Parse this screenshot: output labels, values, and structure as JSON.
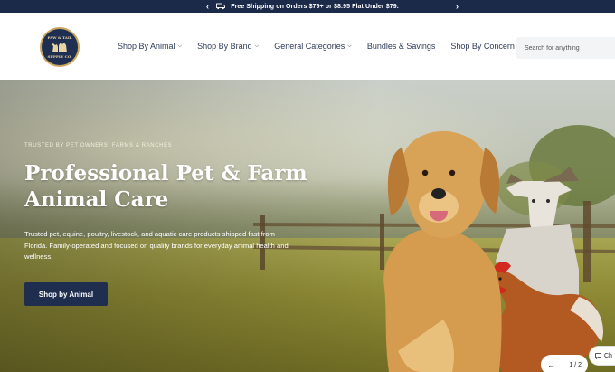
{
  "announcement": {
    "message": "Free Shipping on Orders $79+ or $8.95 Flat Under $79.",
    "prev_icon": "‹",
    "next_icon": "›"
  },
  "header": {
    "logo": {
      "line1": "PAW & TAIL",
      "line2": "SUPPLY CO."
    },
    "nav": [
      {
        "label": "Shop By Animal",
        "has_dropdown": true
      },
      {
        "label": "Shop By Brand",
        "has_dropdown": true
      },
      {
        "label": "General Categories",
        "has_dropdown": true
      },
      {
        "label": "Bundles & Savings",
        "has_dropdown": false
      },
      {
        "label": "Shop By Concern",
        "has_dropdown": false
      }
    ],
    "search": {
      "placeholder": "Search for anything",
      "value": ""
    }
  },
  "hero": {
    "eyebrow": "TRUSTED BY PET OWNERS, FARMS & RANCHES",
    "headline": "Professional Pet & Farm Animal Care",
    "subcopy": "Trusted pet, equine, poultry, livestock, and aquatic care products shipped fast from Florida. Family-operated and focused on quality brands for everyday animal health and wellness.",
    "cta_label": "Shop by Animal",
    "pager": {
      "prev_icon": "←",
      "text": "1 / 2"
    },
    "chat_label": "Ch"
  },
  "colors": {
    "navy": "#1c2a4a",
    "button": "#1f2e4f",
    "logo_gold": "#c9a45c"
  }
}
